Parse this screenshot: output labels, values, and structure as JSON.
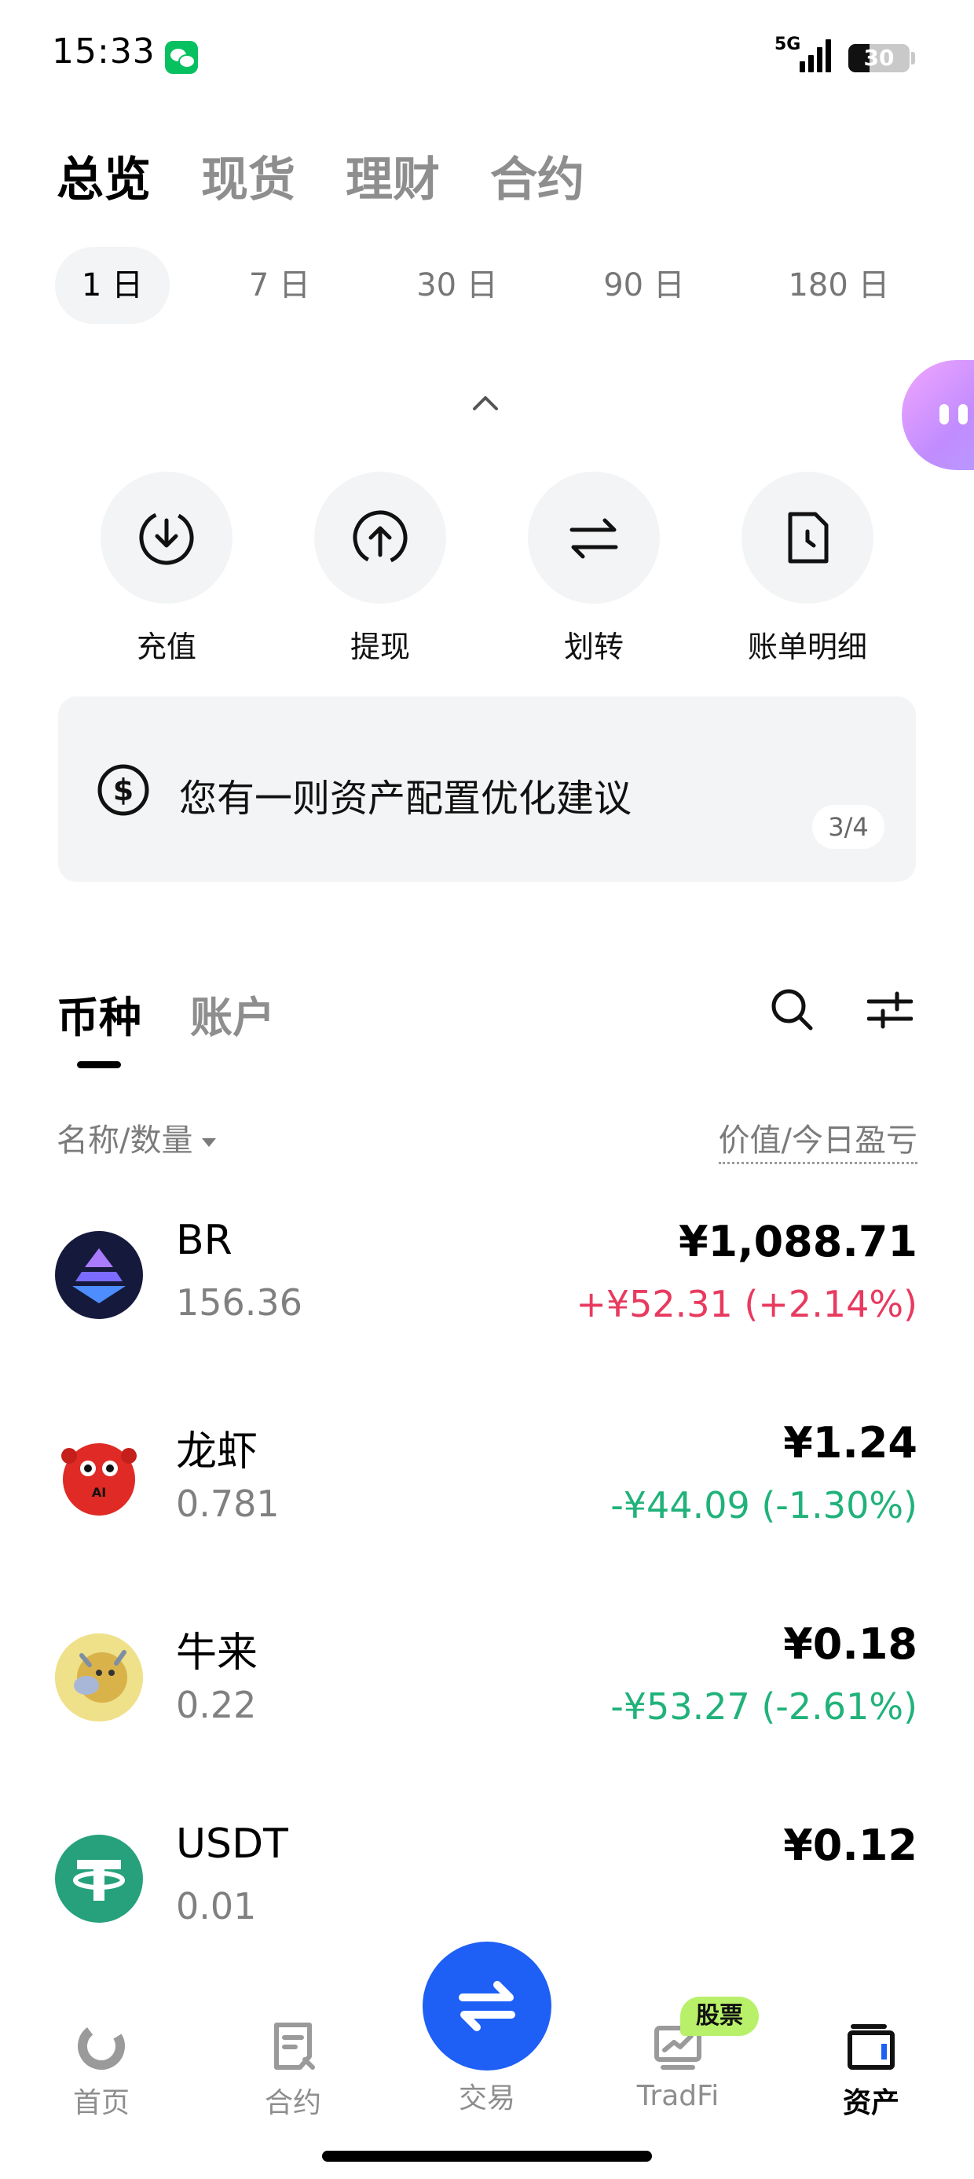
{
  "status_bar": {
    "time": "15:33",
    "network": "5G",
    "battery": "30"
  },
  "top_tabs": [
    {
      "label": "总览",
      "active": true
    },
    {
      "label": "现货",
      "active": false
    },
    {
      "label": "理财",
      "active": false
    },
    {
      "label": "合约",
      "active": false
    }
  ],
  "periods": [
    {
      "label": "1 日",
      "active": true
    },
    {
      "label": "7 日",
      "active": false
    },
    {
      "label": "30 日",
      "active": false
    },
    {
      "label": "90 日",
      "active": false
    },
    {
      "label": "180 日",
      "active": false
    }
  ],
  "quick_actions": [
    {
      "label": "充值",
      "icon": "deposit-icon"
    },
    {
      "label": "提现",
      "icon": "withdraw-icon"
    },
    {
      "label": "划转",
      "icon": "transfer-icon"
    },
    {
      "label": "账单明细",
      "icon": "bill-icon"
    }
  ],
  "banner": {
    "text": "您有一则资产配置优化建议",
    "page": "3/4"
  },
  "asset_tabs": [
    {
      "label": "币种",
      "active": true
    },
    {
      "label": "账户",
      "active": false
    }
  ],
  "columns": {
    "left": "名称/数量",
    "right": "价值/今日盈亏"
  },
  "coins": [
    {
      "name": "BR",
      "qty": "156.36",
      "value": "¥1,088.71",
      "pnl": "+¥52.31 (+2.14%)",
      "direction": "up"
    },
    {
      "name": "龙虾",
      "qty": "0.781",
      "value": "¥1.24",
      "pnl": "-¥44.09 (-1.30%)",
      "direction": "down"
    },
    {
      "name": "牛来",
      "qty": "0.22",
      "value": "¥0.18",
      "pnl": "-¥53.27 (-2.61%)",
      "direction": "down"
    },
    {
      "name": "USDT",
      "qty": "0.01",
      "value": "¥0.12",
      "pnl": "",
      "direction": "none"
    }
  ],
  "bottom_nav": [
    {
      "label": "首页",
      "active": false
    },
    {
      "label": "合约",
      "active": false
    },
    {
      "label": "交易",
      "active": false
    },
    {
      "label": "TradFi",
      "active": false,
      "badge": "股票"
    },
    {
      "label": "资产",
      "active": true
    }
  ],
  "colors": {
    "up": "#e83a5f",
    "down": "#20b27a",
    "accent": "#1e5ff5",
    "badge": "#b8f06a"
  }
}
